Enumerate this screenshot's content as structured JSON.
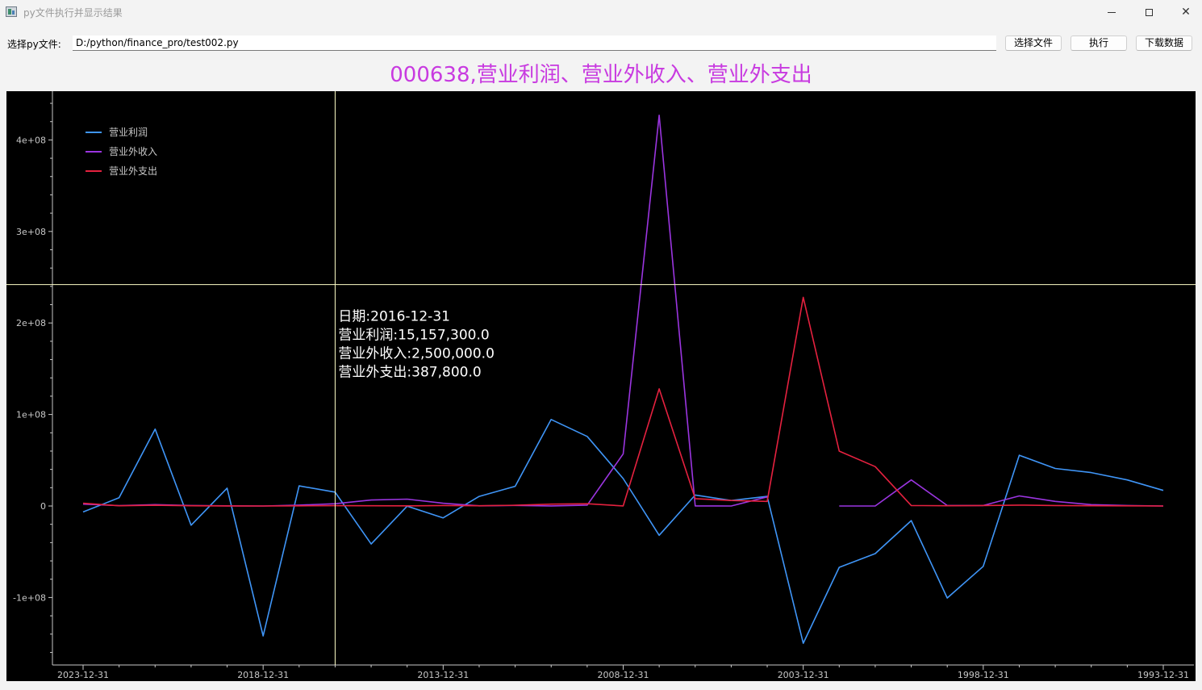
{
  "window": {
    "title": "py文件执行并显示结果",
    "icon": "app-icon",
    "controls": [
      "minimize-icon",
      "maximize-icon",
      "close-icon"
    ]
  },
  "toolbar": {
    "file_label": "选择py文件:",
    "path_value": "D:/python/finance_pro/test002.py",
    "select_button": "选择文件",
    "run_button": "执行",
    "download_button": "下载数据"
  },
  "colors": {
    "title": "#c83ae0",
    "background": "#000000",
    "axis": "#c8c8c8",
    "crosshair": "#ffffc8",
    "series": [
      "#3f95f7",
      "#9b35e0",
      "#e5213f"
    ]
  },
  "chart_data": {
    "type": "line",
    "title": "000638,营业利润、营业外收入、营业外支出",
    "xlabel": "",
    "ylabel": "",
    "x_reversed": true,
    "x_tick_labels": [
      "2023-12-31",
      "2018-12-31",
      "2013-12-31",
      "2008-12-31",
      "2003-12-31",
      "1998-12-31",
      "1993-12-31"
    ],
    "y_tick_labels": [
      "-1e+08",
      "0",
      "1e+08",
      "2e+08",
      "3e+08",
      "4e+08"
    ],
    "ylim": [
      -175000000,
      450000000
    ],
    "grid": false,
    "legend_position": "top-left",
    "x": [
      "2023-12-31",
      "2022-12-31",
      "2021-12-31",
      "2020-12-31",
      "2019-12-31",
      "2018-12-31",
      "2017-12-31",
      "2016-12-31",
      "2015-12-31",
      "2014-12-31",
      "2013-12-31",
      "2012-12-31",
      "2011-12-31",
      "2010-12-31",
      "2009-12-31",
      "2008-12-31",
      "2007-12-31",
      "2006-12-31",
      "2005-12-31",
      "2004-12-31",
      "2003-12-31",
      "2002-12-31",
      "2001-12-31",
      "2000-12-31",
      "1999-12-31",
      "1998-12-31",
      "1997-12-31",
      "1996-12-31",
      "1995-12-31",
      "1994-12-31",
      "1993-12-31"
    ],
    "series": [
      {
        "name": "营业利润",
        "values": [
          -6500000,
          9000000,
          84000000,
          -21000000,
          19500000,
          -142000000,
          22000000,
          15157300,
          -41500000,
          -200000,
          -13000000,
          10500000,
          21500000,
          94500000,
          76000000,
          30000000,
          -32000000,
          12000000,
          6000000,
          10500000,
          -150000000,
          -67000000,
          -52000000,
          -16000000,
          -100500000,
          -66000000,
          55500000,
          41000000,
          36500000,
          28500000,
          17000000
        ]
      },
      {
        "name": "营业外收入",
        "values": [
          2000000,
          400000,
          1500000,
          500000,
          200000,
          0,
          1000000,
          2500000,
          6500000,
          7500000,
          3000000,
          200000,
          600000,
          100000,
          1000000,
          57000000,
          427000000,
          100000,
          0,
          10000000,
          null,
          0,
          0,
          28500000,
          500000,
          500000,
          11000000,
          5000000,
          1500000,
          500000,
          0
        ]
      },
      {
        "name": "营业外支出",
        "values": [
          3000000,
          300000,
          800000,
          300000,
          100000,
          0,
          200000,
          387800,
          300000,
          200000,
          500000,
          300000,
          800000,
          2000000,
          2500000,
          100000,
          128000000,
          8000000,
          6000000,
          5000000,
          228000000,
          60000000,
          43000000,
          500000,
          300000,
          500000,
          1000000,
          500000,
          300000,
          200000,
          0
        ]
      }
    ],
    "crosshair": {
      "date": "2016-12-31",
      "y_value": 242000000,
      "label_date": "日期:2016-12-31",
      "label_profit": "营业利润:15,157,300.0",
      "label_income": "营业外收入:2,500,000.0",
      "label_expense": "营业外支出:387,800.0"
    }
  }
}
